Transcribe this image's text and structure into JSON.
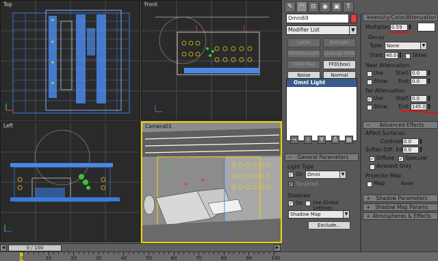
{
  "viewports": {
    "top": "Top",
    "front": "Front",
    "left": "Left",
    "camera": "Camera01"
  },
  "tabs": [
    "create-icon",
    "modify-icon",
    "hierarchy-icon",
    "motion-icon",
    "display-icon",
    "utilities-icon"
  ],
  "left_panel": {
    "object_name": "Omni69",
    "object_color": "#e43c3c",
    "modifier_list": "Modifier List",
    "modifier_buttons": [
      {
        "label": "Lathe",
        "enabled": false
      },
      {
        "label": "Extrude",
        "enabled": false
      },
      {
        "label": "MeshSmooth",
        "enabled": false
      },
      {
        "label": "Unwrap UVW",
        "enabled": false
      },
      {
        "label": "UVW Map",
        "enabled": false
      },
      {
        "label": "FFD(box)",
        "enabled": true
      },
      {
        "label": "Noise",
        "enabled": true
      },
      {
        "label": "Normal",
        "enabled": true
      }
    ],
    "stack_item": "Omni Light",
    "general": {
      "header": "General Parameters",
      "light_type_group": "Light Type",
      "on_label": "On",
      "light_type_value": "Omni",
      "targeted_label": "Targeted",
      "shadows_group": "Shadows",
      "shadows_on_label": "On",
      "use_global_label": "Use Global Settings",
      "shadow_type": "Shadow Map",
      "exclude_button": "Exclude..."
    }
  },
  "right_panel": {
    "intensity_header": "Intensity/Color/Attenuation",
    "multiplier_label": "Multiplier:",
    "multiplier_value": "0.59",
    "light_color": "#ffffff",
    "decay_group": "Decay",
    "type_label": "Type:",
    "type_value": "None",
    "start_label": "Start:",
    "decay_start": "40.0",
    "show_label": "Show",
    "near_group": "Near Attenuation",
    "near_use": "Use",
    "near_start_label": "Start:",
    "near_start": "0.0",
    "near_show": "Show",
    "near_end_label": "End:",
    "near_end": "0.0",
    "far_group": "Far Attenuation",
    "far_use": "Use",
    "far_start_label": "Start:",
    "far_start": "0.0",
    "far_show": "Show",
    "far_end_label": "End:",
    "far_end": "145.0",
    "advanced_header": "Advanced Effects",
    "affect_surfaces": "Affect Surfaces:",
    "contrast_label": "Contrast:",
    "contrast_value": "0.0",
    "soften_label": "Soften Diff. Edge:",
    "soften_value": "0.0",
    "diffuse_label": "Diffuse",
    "specular_label": "Specular",
    "ambient_label": "Ambient Only",
    "projector_group": "Projector Map:",
    "map_label": "Map:",
    "map_button": "None",
    "shadow_params": "Shadow Parameters",
    "shadow_map_params": "Shadow Map Params",
    "atmospheres": "Atmospheres & Effects"
  },
  "timeline": {
    "frame": "0 / 100",
    "ticks": [
      "0",
      "10",
      "20",
      "30",
      "40",
      "50",
      "60",
      "70",
      "80",
      "90",
      "100"
    ]
  }
}
